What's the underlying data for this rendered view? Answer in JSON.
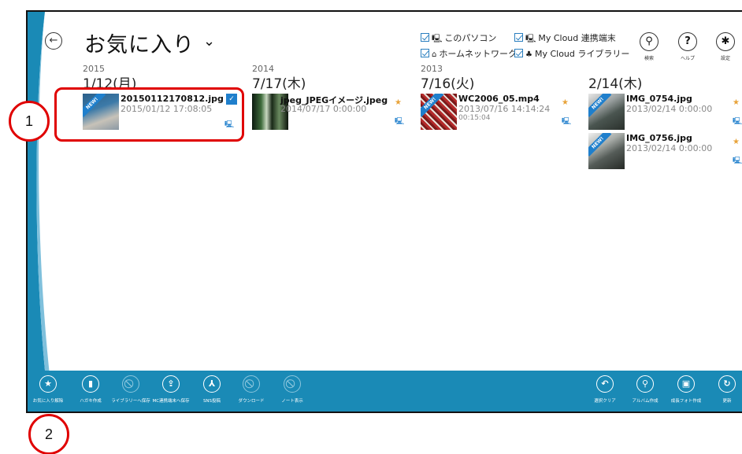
{
  "header": {
    "title": "お気に入り",
    "back_icon": "←",
    "chevron": "⌄"
  },
  "filters": [
    {
      "label": "このパソコン",
      "icon": "pc-icon",
      "checked": true
    },
    {
      "label": "My Cloud 連携端末",
      "icon": "device-icon",
      "checked": true
    },
    {
      "label": "ホームネットワーク",
      "icon": "home-icon",
      "checked": true
    },
    {
      "label": "My Cloud ライブラリー",
      "icon": "library-icon",
      "checked": true
    }
  ],
  "toolbar": {
    "search": "検索",
    "help": "ヘルプ",
    "settings": "設定"
  },
  "groups": [
    {
      "year": "2015",
      "date": "1/12(月)",
      "items": [
        {
          "name": "20150112170812.jpg",
          "datetime": "2015/01/12 17:08:05",
          "new": true,
          "selected": true
        }
      ]
    },
    {
      "year": "2014",
      "date": "7/17(木)",
      "items": [
        {
          "name": "jpeg_JPEGイメージ.jpeg",
          "datetime": "2014/07/17 0:00:00",
          "new": false
        }
      ]
    },
    {
      "year": "2013",
      "date": "7/16(火)",
      "items": [
        {
          "name": "WC2006_05.mp4",
          "datetime": "2013/07/16 14:14:24",
          "duration": "00:15:04",
          "new": true
        }
      ]
    },
    {
      "year": "",
      "date": "2/14(木)",
      "items": [
        {
          "name": "IMG_0754.jpg",
          "datetime": "2013/02/14 0:00:00",
          "new": true
        },
        {
          "name": "IMG_0756.jpg",
          "datetime": "2013/02/14 0:00:00",
          "new": true
        }
      ]
    }
  ],
  "new_label": "NEW!",
  "appbar": {
    "left": [
      {
        "label": "お気に入り解除",
        "icon": "star-remove-icon",
        "enabled": true
      },
      {
        "label": "ハガキ作成",
        "icon": "postcard-icon",
        "enabled": true
      },
      {
        "label": "ライブラリーへ保存",
        "icon": "library-save-icon",
        "enabled": false
      },
      {
        "label": "MC連携端末へ保存",
        "icon": "device-save-icon",
        "enabled": true
      },
      {
        "label": "SNS投稿",
        "icon": "share-icon",
        "enabled": true
      },
      {
        "label": "ダウンロード",
        "icon": "download-icon",
        "enabled": false
      },
      {
        "label": "ノート表示",
        "icon": "note-icon",
        "enabled": false
      }
    ],
    "right": [
      {
        "label": "選択クリア",
        "icon": "clear-selection-icon",
        "enabled": true
      },
      {
        "label": "アルバム作成",
        "icon": "album-icon",
        "enabled": true
      },
      {
        "label": "成長フォト作成",
        "icon": "growth-photo-icon",
        "enabled": true
      },
      {
        "label": "更新",
        "icon": "refresh-icon",
        "enabled": true
      }
    ]
  },
  "annotations": [
    "1",
    "2"
  ],
  "colors": {
    "accent": "#1a8ab6",
    "annotation": "#e00000",
    "star": "#e8a33a"
  }
}
